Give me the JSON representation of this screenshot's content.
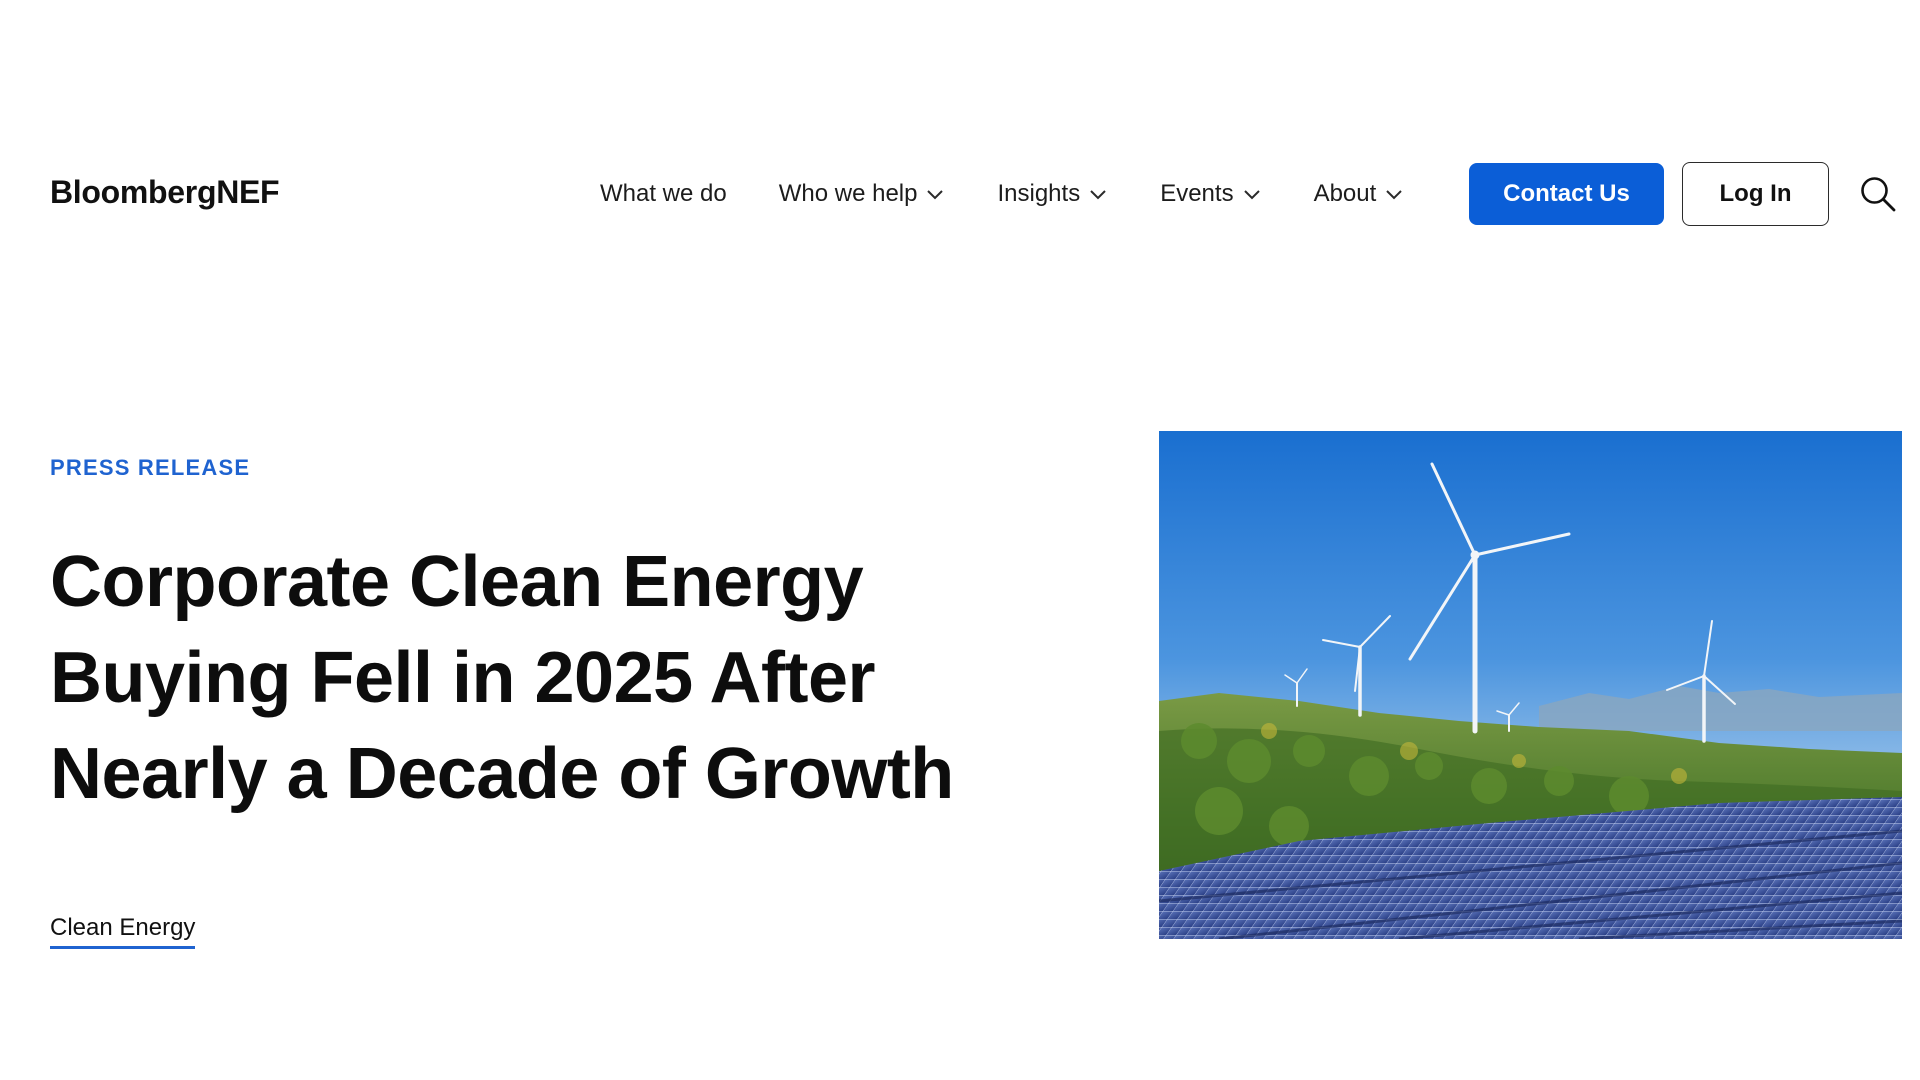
{
  "header": {
    "logo": "BloombergNEF",
    "nav": [
      {
        "label": "What we do",
        "has_dropdown": false
      },
      {
        "label": "Who we help",
        "has_dropdown": true
      },
      {
        "label": "Insights",
        "has_dropdown": true
      },
      {
        "label": "Events",
        "has_dropdown": true
      },
      {
        "label": "About",
        "has_dropdown": true
      }
    ],
    "contact_label": "Contact Us",
    "login_label": "Log In",
    "search_icon": "search-icon"
  },
  "hero": {
    "eyebrow": "PRESS RELEASE",
    "title": "Corporate Clean Energy Buying Fell in 2025 After Nearly a Decade of Growth",
    "tag": "Clean Energy",
    "image": "wind-turbines-and-solar-panels-photo"
  },
  "colors": {
    "accent": "#0b5ed7",
    "eyebrow": "#1f63d0",
    "text": "#111111"
  }
}
